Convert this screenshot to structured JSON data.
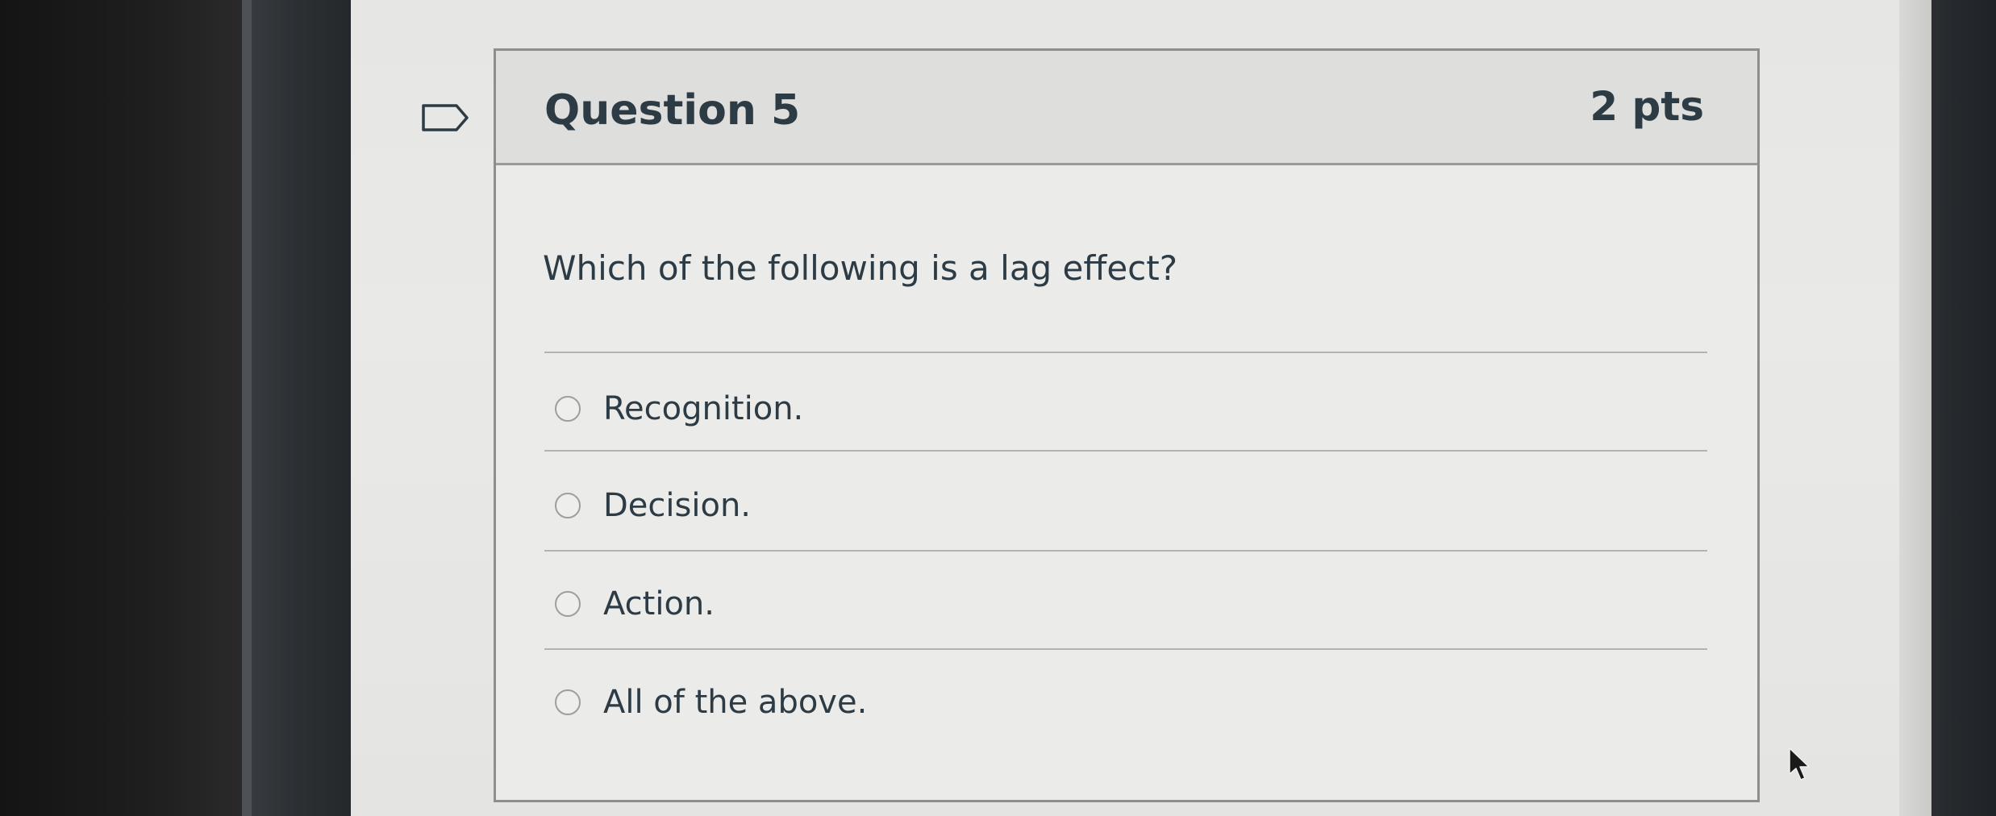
{
  "question": {
    "title": "Question 5",
    "points": "2 pts",
    "prompt": "Which of the following is a lag effect?",
    "flag_icon": "flag-outline-icon"
  },
  "answers": [
    {
      "label": "Recognition.",
      "selected": false
    },
    {
      "label": "Decision.",
      "selected": false
    },
    {
      "label": "Action.",
      "selected": false
    },
    {
      "label": "All of the above.",
      "selected": false
    }
  ],
  "cursor_icon": "mouse-pointer-icon"
}
